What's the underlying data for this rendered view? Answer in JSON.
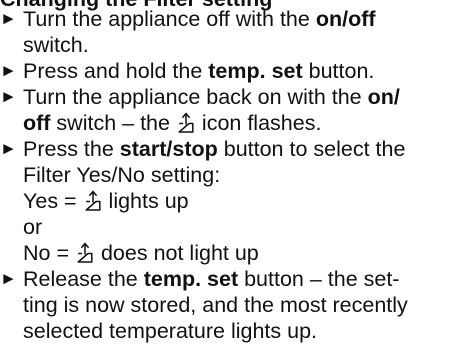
{
  "section": {
    "heading": "Changing the Filter setting"
  },
  "bullet_glyph": "►",
  "filter_icon": "hand-pointer-icon",
  "steps": [
    {
      "lines": [
        {
          "a": "Turn the appliance off with the ",
          "b": "on/off"
        },
        {
          "a": "switch."
        }
      ]
    },
    {
      "lines": [
        {
          "a": "Press and hold the ",
          "b": "temp. set",
          "c": " button."
        }
      ]
    },
    {
      "lines": [
        {
          "a": "Turn the appliance back on with the ",
          "b": "on/"
        },
        {
          "b": "off",
          "c": " switch – the ",
          "d": " icon flashes."
        }
      ]
    },
    {
      "lines": [
        {
          "a": "Press the ",
          "b": "start/stop",
          "c": " button to select the"
        },
        {
          "a": "Filter Yes/No setting:"
        },
        {
          "a": "Yes = ",
          "c": " lights up"
        },
        {
          "a": "or"
        },
        {
          "a": "No = ",
          "c": " does not light up"
        }
      ]
    },
    {
      "lines": [
        {
          "a": "Release the ",
          "b": "temp. set",
          "c": " button – the set-"
        },
        {
          "a": "ting is now stored, and the most recently"
        },
        {
          "a": "selected temperature lights up."
        }
      ]
    }
  ]
}
